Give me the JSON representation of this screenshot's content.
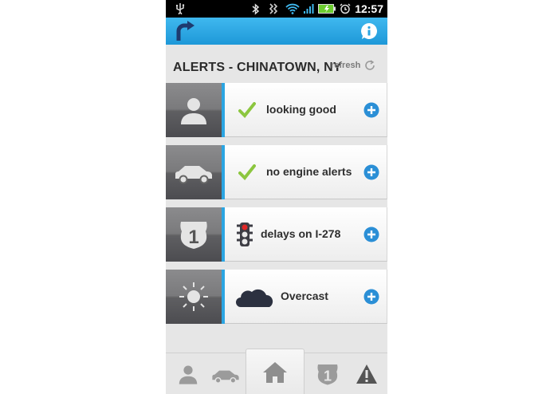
{
  "status_bar": {
    "time": "12:57"
  },
  "header": {
    "title": "ALERTS - CHINATOWN, NY",
    "refresh_label": "refresh"
  },
  "alerts": [
    {
      "category_icon": "person-icon",
      "status_icon": "checkmark-icon",
      "text": "looking good"
    },
    {
      "category_icon": "car-icon",
      "status_icon": "checkmark-icon",
      "text": "no engine alerts"
    },
    {
      "category_icon": "route-shield-icon",
      "status_icon": "traffic-light-icon",
      "text": "delays on I-278"
    },
    {
      "category_icon": "sun-icon",
      "status_icon": "cloud-icon",
      "text": "Overcast"
    }
  ],
  "route_shield_number": "1",
  "bottom_nav": [
    "person-icon",
    "car-icon",
    "home-icon",
    "route-shield-icon",
    "warning-icon"
  ],
  "colors": {
    "accent": "#2ba5e2",
    "check": "#8cc63f",
    "action_bar": "#3fb8ef"
  }
}
